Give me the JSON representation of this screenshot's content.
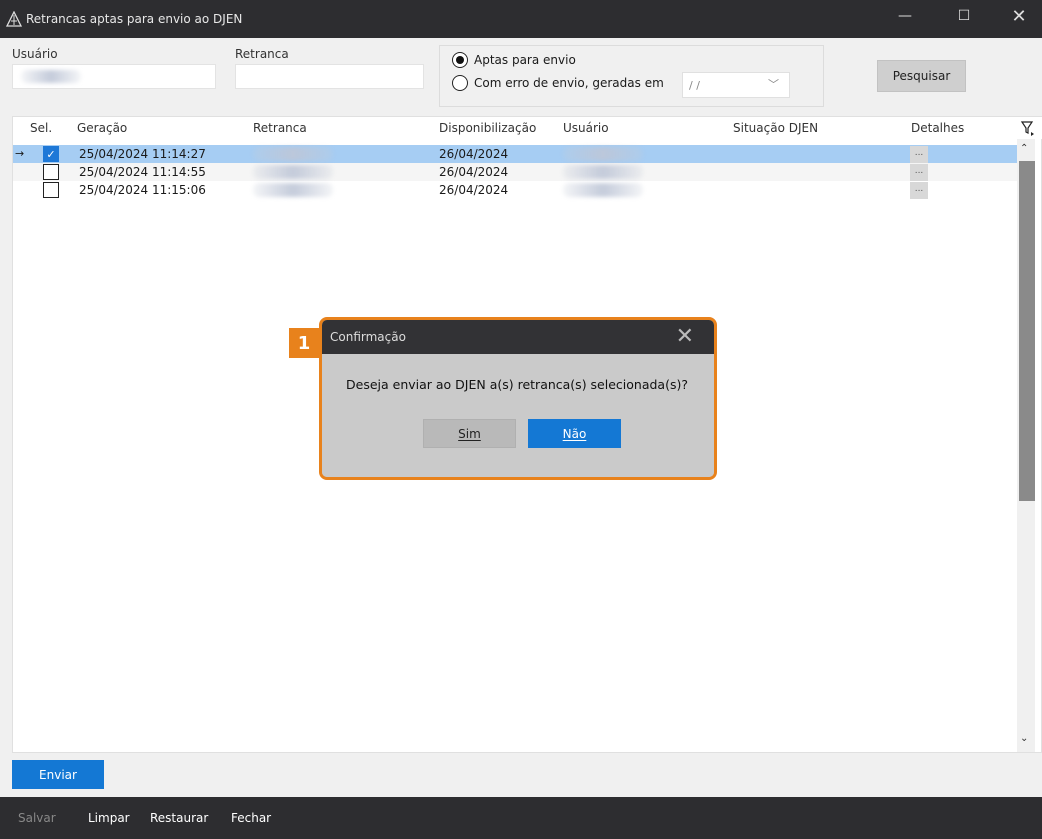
{
  "window": {
    "title": "Retrancas aptas para envio ao DJEN",
    "minimize_glyph": "—",
    "maximize_glyph": "☐",
    "close_glyph": "✕"
  },
  "filters": {
    "usuario_label": "Usuário",
    "retranca_label": "Retranca",
    "radio_aptas_label": "Aptas para envio",
    "radio_erro_label": "Com erro de envio, geradas em",
    "date_placeholder": " /  /",
    "selected_radio": "aptas",
    "pesquisar_label": "Pesquisar"
  },
  "grid": {
    "columns": [
      "Sel.",
      "Geração",
      "Retranca",
      "Disponibilização",
      "Usuário",
      "Situação DJEN",
      "Detalhes"
    ],
    "rows": [
      {
        "selected": true,
        "current": true,
        "geracao": "25/04/2024 11:14:27",
        "disponibilizacao": "26/04/2024",
        "detalhes": "..."
      },
      {
        "selected": false,
        "current": false,
        "geracao": "25/04/2024 11:14:55",
        "disponibilizacao": "26/04/2024",
        "detalhes": "..."
      },
      {
        "selected": false,
        "current": false,
        "geracao": "25/04/2024 11:15:06",
        "disponibilizacao": "26/04/2024",
        "detalhes": "..."
      }
    ],
    "row_indicator": "→",
    "filter_icon": "filter-icon"
  },
  "actions": {
    "enviar_label": "Enviar"
  },
  "footer": {
    "salvar": "Salvar",
    "limpar": "Limpar",
    "restaurar": "Restaurar",
    "fechar": "Fechar"
  },
  "dialog": {
    "badge": "1",
    "title": "Confirmação",
    "close_glyph": "✕",
    "message": "Deseja enviar ao DJEN a(s) retranca(s) selecionada(s)?",
    "yes_label": "Sim",
    "no_label": "Não"
  },
  "colors": {
    "accent_blue": "#1478d4",
    "highlight_orange": "#e8821c",
    "selected_row": "#a6cdf3",
    "titlebar": "#2d2d30"
  }
}
